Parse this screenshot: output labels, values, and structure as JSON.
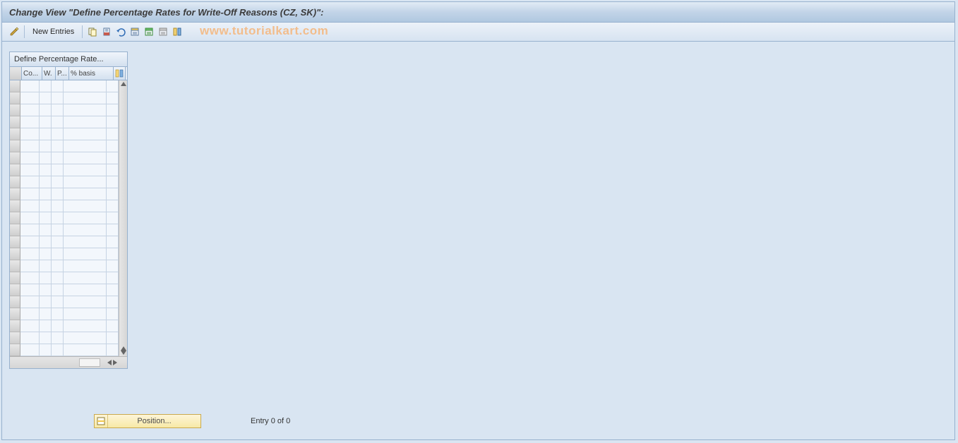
{
  "header": {
    "title": "Change View \"Define Percentage Rates for Write-Off Reasons (CZ, SK)\":"
  },
  "toolbar": {
    "new_entries_label": "New Entries"
  },
  "watermark": "www.tutorialkart.com",
  "table": {
    "title": "Define Percentage Rate...",
    "columns": {
      "co": "Co...",
      "w": "W.",
      "p": "P...",
      "pct": "% basis"
    },
    "row_count": 23
  },
  "footer": {
    "position_label": "Position...",
    "entry_text": "Entry 0 of 0"
  }
}
